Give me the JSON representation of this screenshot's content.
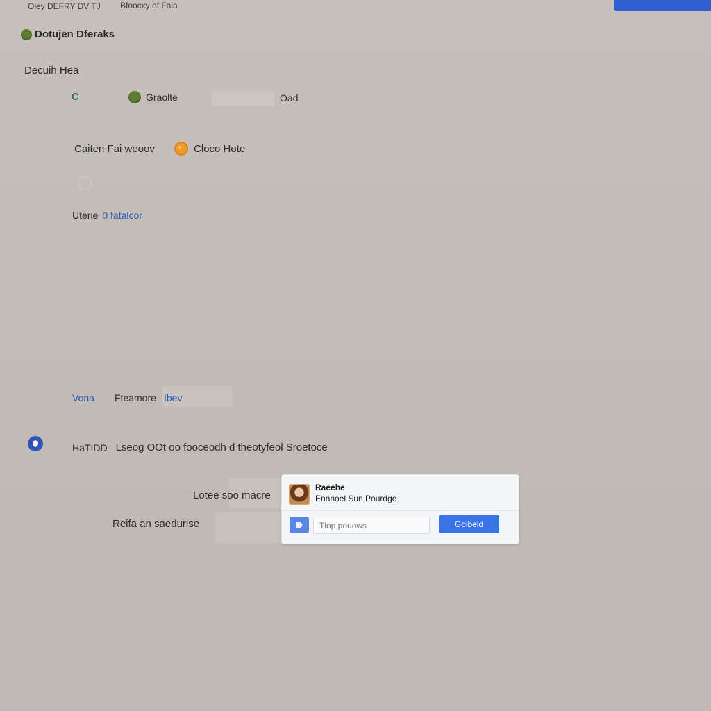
{
  "topbar": {
    "left_text": "Oiey DEFRY DV TJ",
    "mid_text": "Bfoocxy of Fala"
  },
  "header": {
    "title": "Dotujen Dferaks"
  },
  "section": {
    "heading": "Decuih Hea"
  },
  "row1": {
    "back_glyph": "C",
    "label": "Graolte",
    "right_label": "Oad"
  },
  "row2": {
    "left_label": "Caiten Fai weoov",
    "right_label": "Cloco Hote"
  },
  "row3": {
    "prefix": "Uterie",
    "link": "0 fatalcor"
  },
  "tabs": {
    "a": "Vona",
    "b": "Fteamore",
    "c": "Ibev"
  },
  "notice": {
    "prefix": "HaTIDD",
    "text": "Lseog OOt oo fooceodh d theotyfeol Sroetoce"
  },
  "fields": {
    "loc_label": "Lotee soo macre",
    "reply_label": "Reifa an saedurise"
  },
  "popup": {
    "title": "Raeehe",
    "subtitle": "Ennnoel Sun Pourdge",
    "input_placeholder": "Tlop pouows",
    "button_label": "Goibeld"
  },
  "colors": {
    "accent_blue": "#2f5fd0",
    "button_blue": "#3a74e6",
    "green_status": "#5f7d33",
    "orange_status": "#f09a2a",
    "background": "#c3bdb7"
  }
}
